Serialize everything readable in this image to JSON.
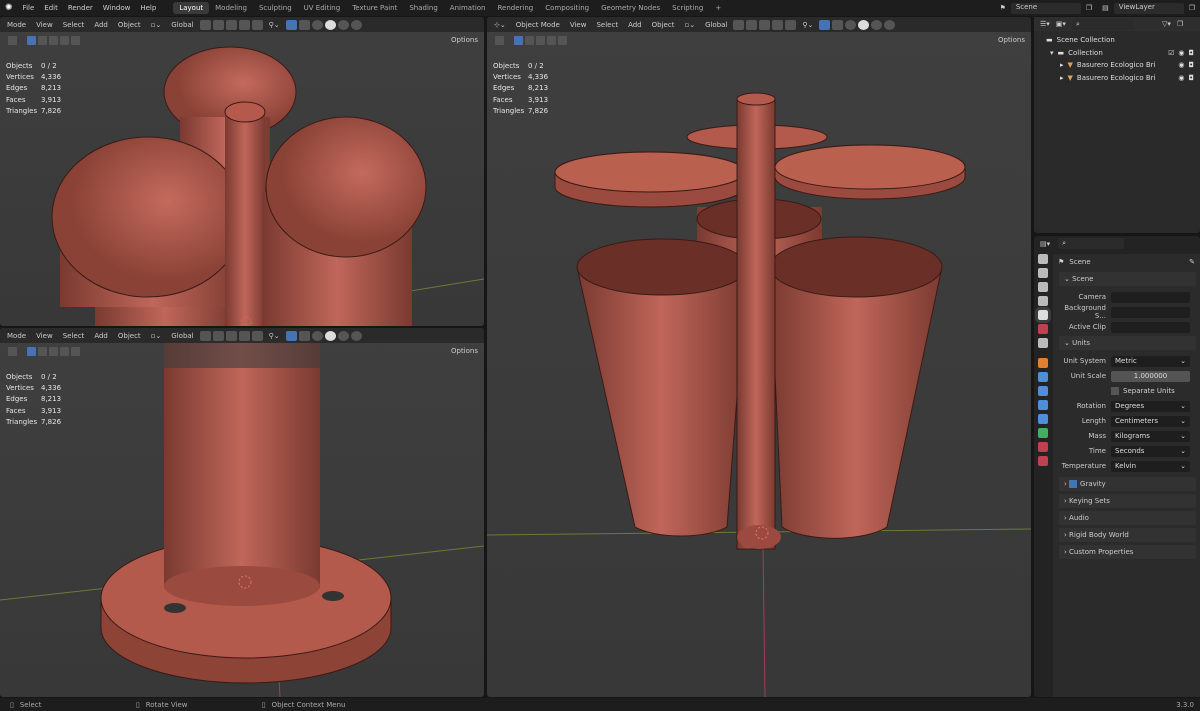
{
  "topbar": {
    "menus": [
      "File",
      "Edit",
      "Render",
      "Window",
      "Help"
    ],
    "workspaces": [
      "Layout",
      "Modeling",
      "Sculpting",
      "UV Editing",
      "Texture Paint",
      "Shading",
      "Animation",
      "Rendering",
      "Compositing",
      "Geometry Nodes",
      "Scripting",
      "+"
    ],
    "active_workspace": "Layout",
    "scene": "Scene",
    "view_layer": "ViewLayer"
  },
  "viewports": [
    {
      "mode": "Mode",
      "menus": [
        "View",
        "Select",
        "Add",
        "Object"
      ],
      "orientation": "Global",
      "options": "Options"
    },
    {
      "mode": "Mode",
      "menus": [
        "View",
        "Select",
        "Add",
        "Object"
      ],
      "orientation": "Global",
      "options": "Options"
    },
    {
      "mode": "Object Mode",
      "menus": [
        "View",
        "Select",
        "Add",
        "Object"
      ],
      "orientation": "Global",
      "options": "Options"
    }
  ],
  "stats": [
    [
      "Objects",
      "0 / 2"
    ],
    [
      "Vertices",
      "4,336"
    ],
    [
      "Edges",
      "8,213"
    ],
    [
      "Faces",
      "3,913"
    ],
    [
      "Triangles",
      "7,826"
    ]
  ],
  "outliner": {
    "root": "Scene Collection",
    "collection": "Collection",
    "objects": [
      "Basurero Ecologico Bri",
      "Basurero Ecologico Bri"
    ]
  },
  "properties": {
    "header": "Scene",
    "scene_section": "Scene",
    "scene_rows": [
      [
        "Camera",
        ""
      ],
      [
        "Background S...",
        ""
      ],
      [
        "Active Clip",
        ""
      ]
    ],
    "units_section": "Units",
    "unit_system": [
      "Unit System",
      "Metric"
    ],
    "unit_scale": [
      "Unit Scale",
      "1.000000"
    ],
    "separate_units": "Separate Units",
    "unit_rows": [
      [
        "Rotation",
        "Degrees"
      ],
      [
        "Length",
        "Centimeters"
      ],
      [
        "Mass",
        "Kilograms"
      ],
      [
        "Time",
        "Seconds"
      ],
      [
        "Temperature",
        "Kelvin"
      ]
    ],
    "collapsed": [
      "Gravity",
      "Keying Sets",
      "Audio",
      "Rigid Body World",
      "Custom Properties"
    ],
    "gravity_checked": true
  },
  "status": {
    "items": [
      "Select",
      "Rotate View",
      "Object Context Menu"
    ],
    "version": "3.3.0"
  },
  "colors": {
    "mesh": "#b35a4c",
    "accent": "#4772b3",
    "viewport": "#3d3d3d"
  }
}
